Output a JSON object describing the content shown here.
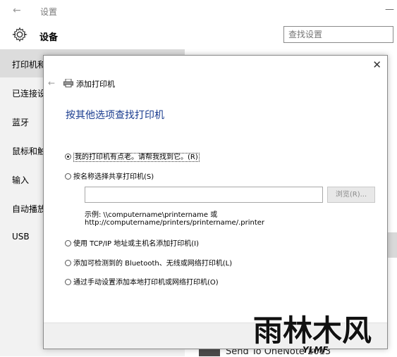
{
  "settings": {
    "window_title": "设置",
    "header": "设备",
    "search_placeholder": "查找设置",
    "sidebar_items": [
      "打印机和",
      "已连接设",
      "蓝牙",
      "鼠标和触",
      "输入",
      "自动播放",
      "USB"
    ],
    "onenote_text": "Send To OneNote 2013"
  },
  "dialog": {
    "caption": "添加打印机",
    "heading": "按其他选项查找打印机",
    "options": [
      {
        "label": "我的打印机有点老。请帮我找到它。(R)",
        "checked": true
      },
      {
        "label": "按名称选择共享打印机(S)",
        "checked": false
      },
      {
        "label": "使用 TCP/IP 地址或主机名添加打印机(I)",
        "checked": false
      },
      {
        "label": "添加可检测到的 Bluetooth、无线或网络打印机(L)",
        "checked": false
      },
      {
        "label": "通过手动设置添加本地打印机或网络打印机(O)",
        "checked": false
      }
    ],
    "browse_label": "浏览(R)...",
    "example_line1": "示例: \\\\computername\\printername 或",
    "example_line2": "http://computername/printers/printername/.printer",
    "share_value": ""
  },
  "watermark": {
    "main": "雨林木风",
    "sub": "YLMF"
  }
}
